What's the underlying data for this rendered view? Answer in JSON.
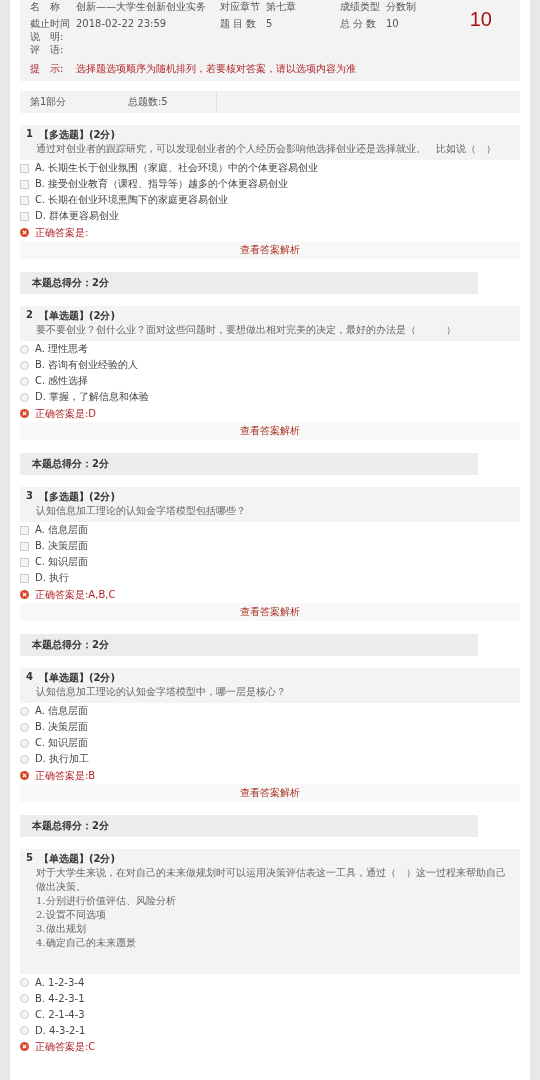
{
  "header": {
    "fields": [
      {
        "label": "名　称",
        "value": "创新——大学生创新创业实务"
      },
      {
        "label": "对应章节",
        "value": "第七章"
      },
      {
        "label": "成绩类型",
        "value": "分数制"
      },
      {
        "label": "截止时间",
        "value": "2018-02-22 23:59"
      },
      {
        "label": "题 目 数",
        "value": "5"
      },
      {
        "label": "总 分 数",
        "value": "10"
      }
    ],
    "score": "10",
    "note_label": "说　明:",
    "comment_label": "评　语:",
    "tip_label": "提　示:",
    "tip": "选择题选项顺序为随机排列，若要核对答案，请以选项内容为准"
  },
  "part": {
    "name": "第1部分",
    "count": "总题数:5"
  },
  "questions": [
    {
      "number": "1",
      "type": "【多选题】",
      "points": "(2分)",
      "kind": "multiple",
      "text": [
        "通过对创业者的跟踪研究，可以发现创业者的个人经历会影响他选择创业还是选择就业。　比如说（　）"
      ],
      "options": [
        {
          "label": "A.  长期生长于创业氛围（家庭、社会环境）中的个体更容易创业",
          "checked": false
        },
        {
          "label": "B.  接受创业教育（课程、指导等）越多的个体更容易创业",
          "checked": false
        },
        {
          "label": "C.  长期在创业环境熏陶下的家庭更容易创业",
          "checked": false
        },
        {
          "label": "D.  群体更容易创业",
          "checked": false
        }
      ],
      "answer": "正确答案是:",
      "analysis": "查看答案解析",
      "total": "本题总得分：2分"
    },
    {
      "number": "2",
      "type": "【单选题】",
      "points": "(2分)",
      "kind": "single",
      "text": [
        "要不要创业？创什么业？面对这些问题时，要想做出相对完美的决定，最好的办法是（　　　）"
      ],
      "options": [
        {
          "label": "A.  理性思考",
          "checked": false
        },
        {
          "label": "B.  咨询有创业经验的人",
          "checked": false
        },
        {
          "label": "C.  感性选择",
          "checked": false
        },
        {
          "label": "D.  掌握，了解信息和体验",
          "checked": false
        }
      ],
      "answer": "正确答案是:D",
      "analysis": "查看答案解析",
      "total": "本题总得分：2分"
    },
    {
      "number": "3",
      "type": "【多选题】",
      "points": "(2分)",
      "kind": "multiple",
      "text": [
        "认知信息加工理论的认知金字塔模型包括哪些？"
      ],
      "options": [
        {
          "label": "A.  信息层面",
          "checked": false
        },
        {
          "label": "B.  决策层面",
          "checked": false
        },
        {
          "label": "C.  知识层面",
          "checked": false
        },
        {
          "label": "D.  执行",
          "checked": false
        }
      ],
      "answer": "正确答案是:A,B,C",
      "analysis": "查看答案解析",
      "total": "本题总得分：2分"
    },
    {
      "number": "4",
      "type": "【单选题】",
      "points": "(2分)",
      "kind": "single",
      "text": [
        "认知信息加工理论的认知金字塔模型中，哪一层是核心？"
      ],
      "options": [
        {
          "label": "A.  信息层面",
          "checked": false
        },
        {
          "label": "B.  决策层面",
          "checked": false
        },
        {
          "label": "C.  知识层面",
          "checked": false
        },
        {
          "label": "D.  执行加工",
          "checked": false
        }
      ],
      "answer": "正确答案是:B",
      "analysis": "查看答案解析",
      "total": "本题总得分：2分"
    },
    {
      "number": "5",
      "type": "【单选题】",
      "points": "(2分)",
      "kind": "single",
      "text": [
        "对于大学生来说，在对自己的未来做规划时可以运用决策评估表这一工具，通过（　）这一过程来帮助自己做出决策。",
        "1.分别进行价值评估、风险分析",
        "2.设置不同选项",
        "3.做出规划",
        "4.确定自己的未来愿景"
      ],
      "options": [
        {
          "label": "A.  1-2-3-4",
          "checked": false
        },
        {
          "label": "B.  4-2-3-1",
          "checked": false
        },
        {
          "label": "C.  2-1-4-3",
          "checked": false
        },
        {
          "label": "D.  4-3-2-1",
          "checked": false
        }
      ],
      "answer": "正确答案是:C"
    }
  ]
}
